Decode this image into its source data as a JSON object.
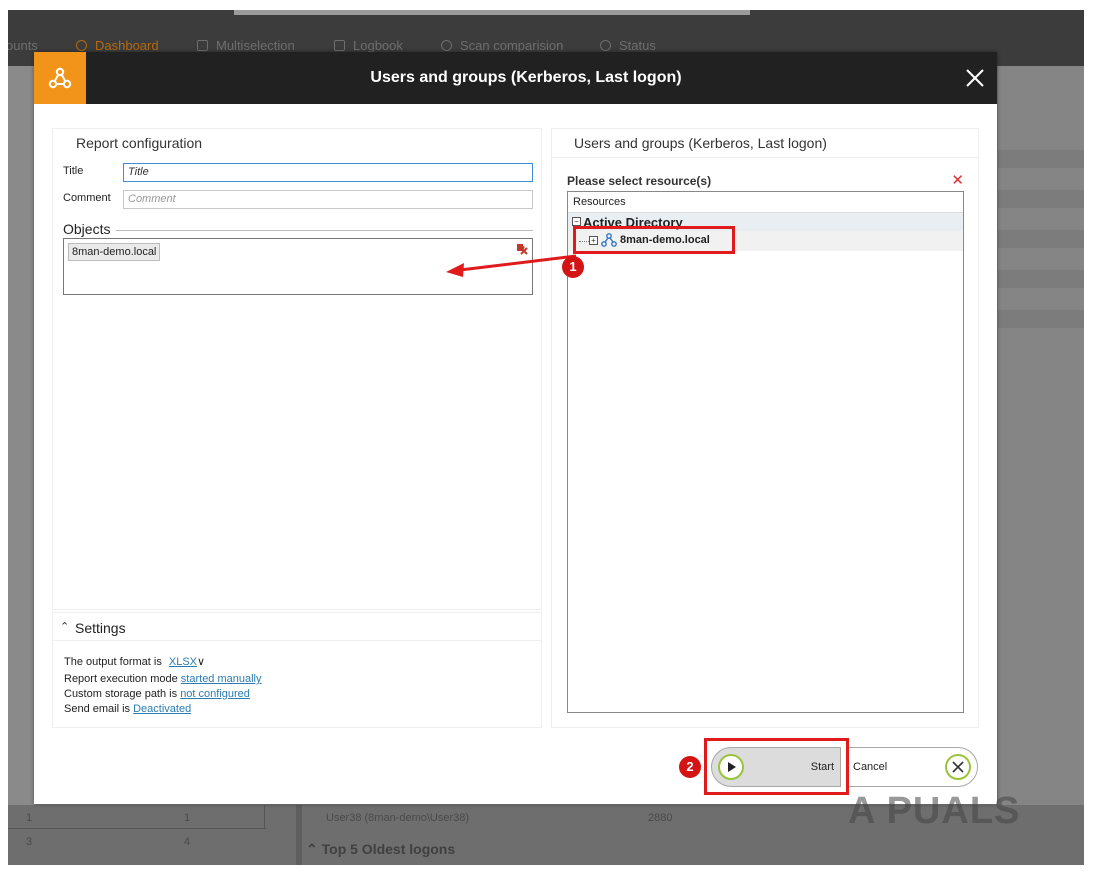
{
  "background_app": {
    "nav": {
      "accounts_partial": "ounts",
      "dashboard": "Dashboard",
      "multiselection": "Multiselection",
      "logbook": "Logbook",
      "scan_comparision": "Scan comparision",
      "status": "Status"
    },
    "table": {
      "row1_col1": "1",
      "row1_col2": "1",
      "row2_col1": "3",
      "row2_col2": "4",
      "user": "User38 (8man-demo\\User38)",
      "user_value": "2880",
      "section_title": "Top 5 Oldest logons"
    }
  },
  "dialog": {
    "title": "Users and groups (Kerberos, Last logon)",
    "logo_icon": "network-nodes-icon",
    "close_icon": "close-icon",
    "report_config": {
      "section_title": "Report configuration",
      "title_label": "Title",
      "title_placeholder": "Title",
      "comment_label": "Comment",
      "comment_placeholder": "Comment",
      "objects_label": "Objects",
      "objects": [
        "8man-demo.local"
      ]
    },
    "settings": {
      "section_title": "Settings",
      "output_format_prefix": "The output format is",
      "output_format_value": "XLSX",
      "execution_mode_prefix": "Report execution mode",
      "execution_mode_value": "started manually",
      "storage_path_prefix": "Custom storage path is",
      "storage_path_value": "not configured",
      "send_email_prefix": "Send email is",
      "send_email_value": "Deactivated"
    },
    "resources": {
      "section_title": "Users and groups (Kerberos, Last logon)",
      "select_label": "Please select resource(s)",
      "column_header": "Resources",
      "tree_root": "Active Directory",
      "tree_child": "8man-demo.local"
    },
    "buttons": {
      "start": "Start",
      "cancel": "Cancel"
    }
  },
  "annotations": {
    "badge1": "1",
    "badge2": "2",
    "watermark": "A  PUALS"
  },
  "colors": {
    "accent_orange": "#f29419",
    "header_dark": "#212121",
    "annotation_red": "#e01b1b",
    "button_ring_green": "#9ac33c",
    "link_blue": "#2c7cb0"
  }
}
